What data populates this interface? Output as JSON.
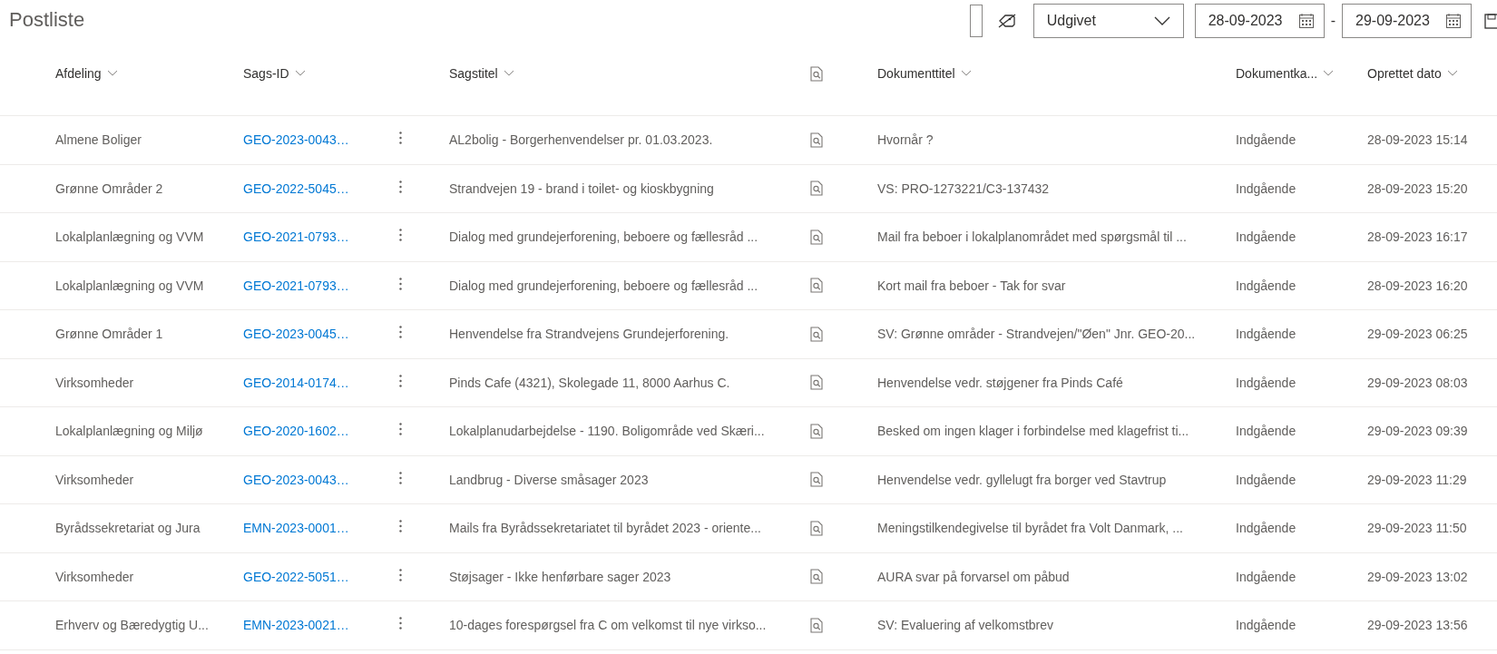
{
  "page_title": "Postliste",
  "toolbar": {
    "status_dropdown": {
      "value": "Udgivet"
    },
    "date_from": {
      "value": "28-09-2023"
    },
    "date_separator": "-",
    "date_to": {
      "value": "29-09-2023"
    }
  },
  "table": {
    "columns": [
      {
        "kind": "text",
        "label": "Afdeling"
      },
      {
        "kind": "text",
        "label": "Sags-ID"
      },
      {
        "kind": "text",
        "label": "Sagstitel"
      },
      {
        "kind": "icon"
      },
      {
        "kind": "text",
        "label": "Dokumenttitel"
      },
      {
        "kind": "text",
        "label": "Dokumentka..."
      },
      {
        "kind": "text",
        "label": "Oprettet dato"
      }
    ],
    "rows": [
      {
        "department": "Almene Boliger",
        "case_id": "GEO-2023-0043…",
        "case_title": "AL2bolig - Borgerhenvendelser pr. 01.03.2023.",
        "document_title": "Hvornår ?",
        "document_category": "Indgående",
        "created": "28-09-2023 15:14"
      },
      {
        "department": "Grønne Områder 2",
        "case_id": "GEO-2022-5045…",
        "case_title": "Strandvejen 19 - brand i toilet- og kioskbygning",
        "document_title": "VS: PRO-1273221/C3-137432",
        "document_category": "Indgående",
        "created": "28-09-2023 15:20"
      },
      {
        "department": "Lokalplanlægning og VVM",
        "case_id": "GEO-2021-0793…",
        "case_title": "Dialog med grundejerforening, beboere og fællesråd ...",
        "document_title": "Mail fra beboer i lokalplanområdet med spørgsmål til ...",
        "document_category": "Indgående",
        "created": "28-09-2023 16:17"
      },
      {
        "department": "Lokalplanlægning og VVM",
        "case_id": "GEO-2021-0793…",
        "case_title": "Dialog med grundejerforening, beboere og fællesråd ...",
        "document_title": "Kort mail fra beboer - Tak for svar",
        "document_category": "Indgående",
        "created": "28-09-2023 16:20"
      },
      {
        "department": "Grønne Områder 1",
        "case_id": "GEO-2023-0045…",
        "case_title": "Henvendelse fra Strandvejens Grundejerforening.",
        "document_title": "SV: Grønne områder - Strandvejen/\"Øen\" Jnr. GEO-20...",
        "document_category": "Indgående",
        "created": "29-09-2023 06:25"
      },
      {
        "department": "Virksomheder",
        "case_id": "GEO-2014-0174…",
        "case_title": "Pinds Cafe (4321), Skolegade 11, 8000 Aarhus C.",
        "document_title": "Henvendelse vedr. støjgener fra Pinds Café",
        "document_category": "Indgående",
        "created": "29-09-2023 08:03"
      },
      {
        "department": "Lokalplanlægning og Miljø",
        "case_id": "GEO-2020-1602…",
        "case_title": "Lokalplanudarbejdelse - 1190. Boligområde ved Skæri...",
        "document_title": "Besked om ingen klager i forbindelse med klagefrist ti...",
        "document_category": "Indgående",
        "created": "29-09-2023 09:39"
      },
      {
        "department": "Virksomheder",
        "case_id": "GEO-2023-0043…",
        "case_title": "Landbrug - Diverse småsager 2023",
        "document_title": "Henvendelse vedr. gyllelugt fra borger ved Stavtrup",
        "document_category": "Indgående",
        "created": "29-09-2023 11:29"
      },
      {
        "department": "Byrådssekretariat og Jura",
        "case_id": "EMN-2023-0001…",
        "case_title": "Mails fra Byrådssekretariatet til byrådet 2023 - oriente...",
        "document_title": "Meningstilkendegivelse til byrådet fra Volt Danmark, ...",
        "document_category": "Indgående",
        "created": "29-09-2023 11:50"
      },
      {
        "department": "Virksomheder",
        "case_id": "GEO-2022-5051…",
        "case_title": "Støjsager - Ikke henførbare sager 2023",
        "document_title": "AURA svar på forvarsel om påbud",
        "document_category": "Indgående",
        "created": "29-09-2023 13:02"
      },
      {
        "department": "Erhverv og Bæredygtig U...",
        "case_id": "EMN-2023-0021…",
        "case_title": "10-dages forespørgsel fra C om velkomst til nye virkso...",
        "document_title": "SV: Evaluering af velkomstbrev",
        "document_category": "Indgående",
        "created": "29-09-2023 13:56"
      }
    ]
  }
}
